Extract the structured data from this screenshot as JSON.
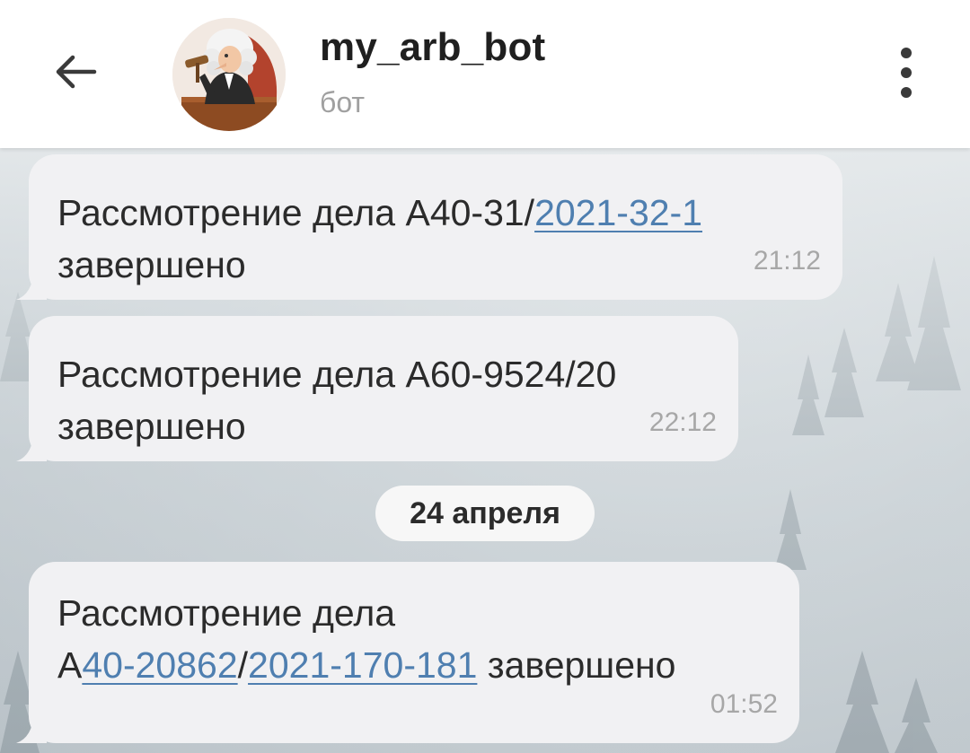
{
  "header": {
    "title": "my_arb_bot",
    "subtitle": "бот",
    "back_icon": "arrow-left-icon",
    "menu_icon": "more-vertical-icon"
  },
  "messages": [
    {
      "prefix": "Рассмотрение дела А40-31/",
      "link": "2021-32-1",
      "suffix": "завершено",
      "time": "21:12"
    },
    {
      "line1": "Рассмотрение дела А60-9524/20",
      "line2": "завершено",
      "time": "22:12"
    },
    {
      "line1": "Рассмотрение дела",
      "prefix": "А",
      "link1": "40-20862",
      "sep": "/",
      "link2": "2021-170-181",
      "suffix": " завершено",
      "time": "01:52"
    }
  ],
  "date_separator": "24 апреля",
  "colors": {
    "link": "#4f7fb0",
    "bubble": "#f1f1f3",
    "header": "#ffffff"
  }
}
